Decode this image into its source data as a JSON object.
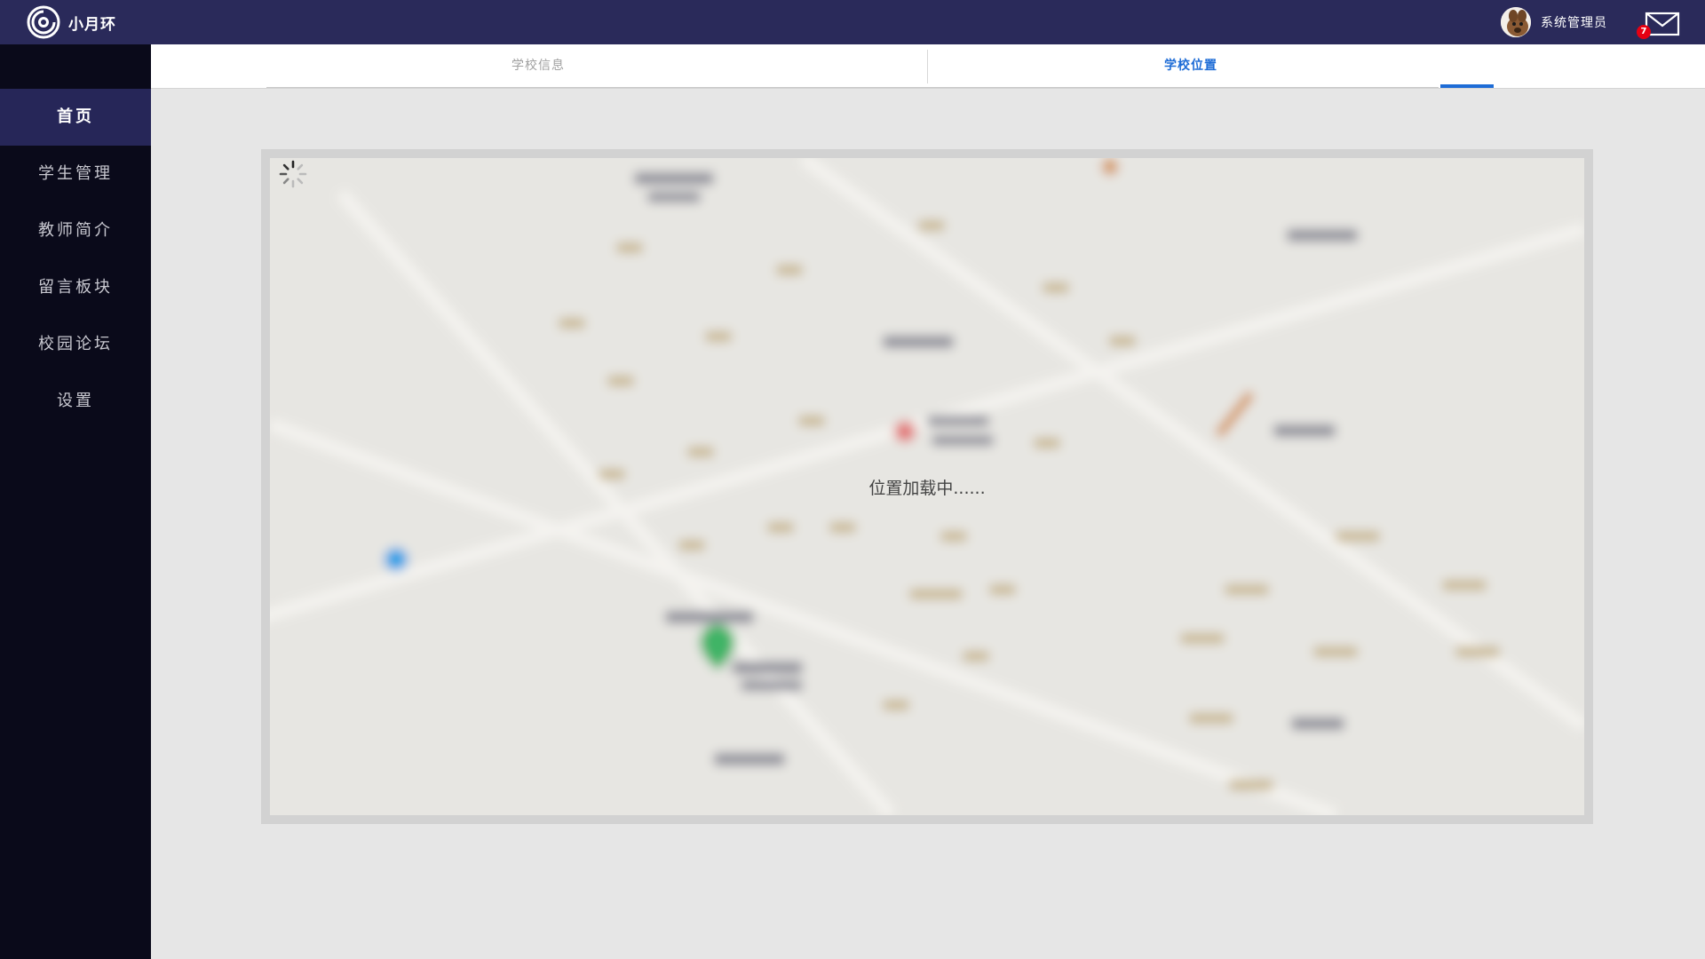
{
  "app": {
    "name": "小月环",
    "user": "系统管理员",
    "unread_count": "7"
  },
  "sidebar": {
    "items": [
      {
        "label": "首页",
        "active": true
      },
      {
        "label": "学生管理",
        "active": false
      },
      {
        "label": "教师简介",
        "active": false
      },
      {
        "label": "留言板块",
        "active": false
      },
      {
        "label": "校园论坛",
        "active": false
      },
      {
        "label": "设置",
        "active": false
      }
    ]
  },
  "tabs": [
    {
      "label": "学校信息",
      "active": false
    },
    {
      "label": "学校位置",
      "active": true
    }
  ],
  "map": {
    "loading_text": "位置加载中......"
  },
  "colors": {
    "header": "#2a2a5a",
    "sidebar": "#0a0a1a",
    "sidebar_active": "#262658",
    "accent": "#1e6cd6",
    "badge": "#e60012"
  }
}
